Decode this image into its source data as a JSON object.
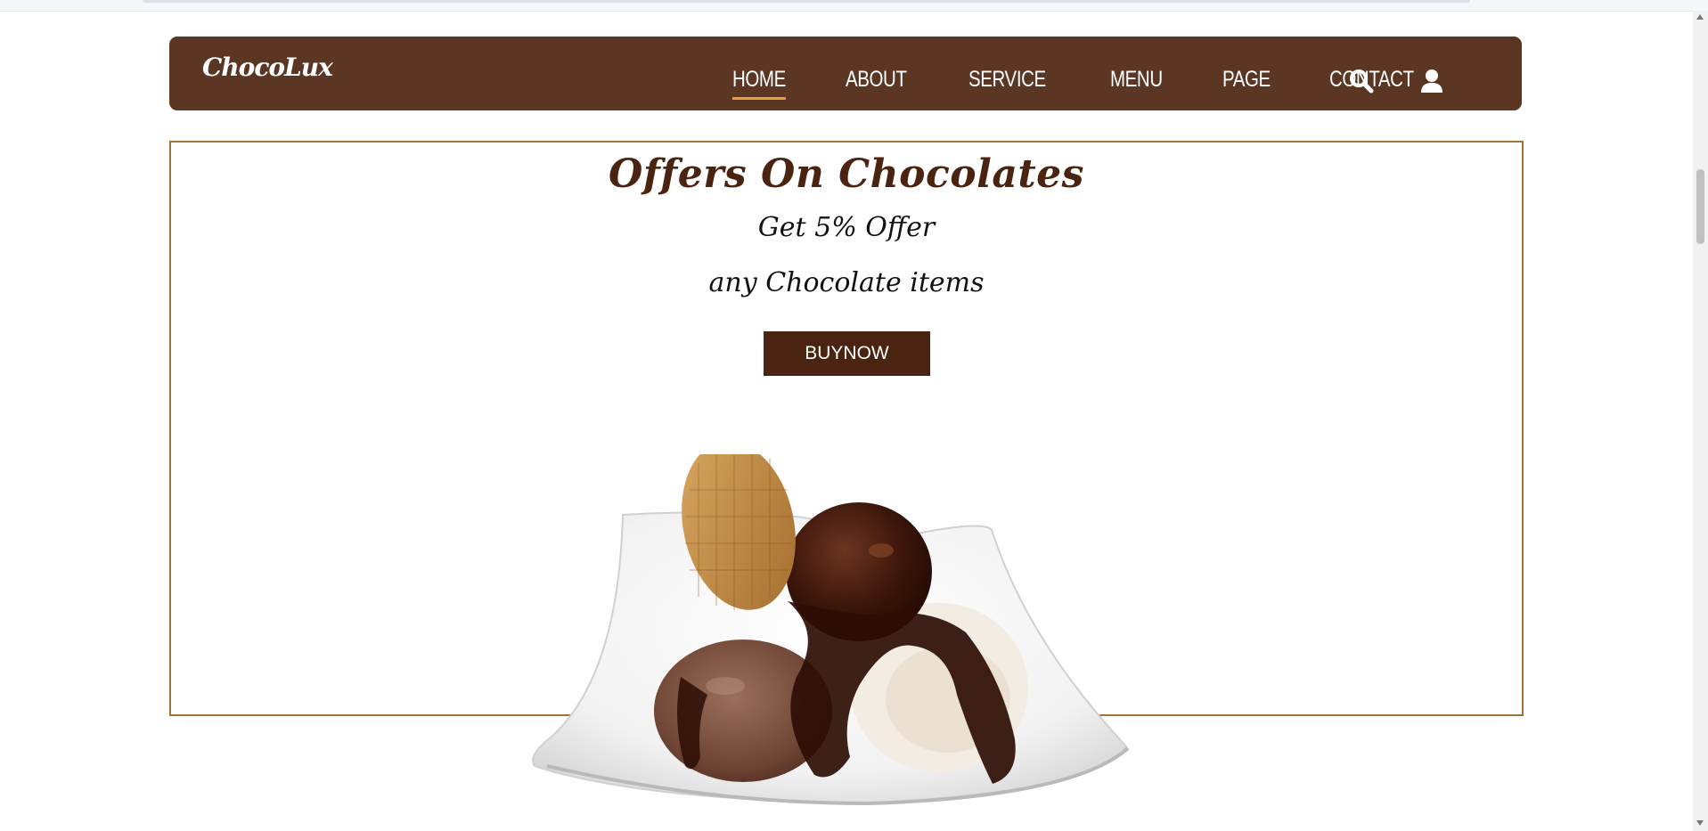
{
  "brand": {
    "logo_text": "ChocoLux",
    "primary_color": "#5b3623",
    "accent_color": "#e0a43a",
    "dark_brown": "#4a2410",
    "banner_border_color": "#a4733a"
  },
  "nav": {
    "items": [
      {
        "label": "HOME",
        "active": true
      },
      {
        "label": "ABOUT",
        "active": false
      },
      {
        "label": "SERVICE",
        "active": false
      },
      {
        "label": "MENU",
        "active": false
      },
      {
        "label": "PAGE",
        "active": false
      },
      {
        "label": "CONTACT",
        "active": false
      }
    ],
    "icons": [
      "search-icon",
      "user-icon"
    ]
  },
  "banner": {
    "title": "Offers On Chocolates",
    "subtitle_line1": "Get 5% Offer",
    "subtitle_line2": "any Chocolate items",
    "button_label": "BUYNOW",
    "image": "chocolate-ice-cream-sundae-with-wafer"
  }
}
